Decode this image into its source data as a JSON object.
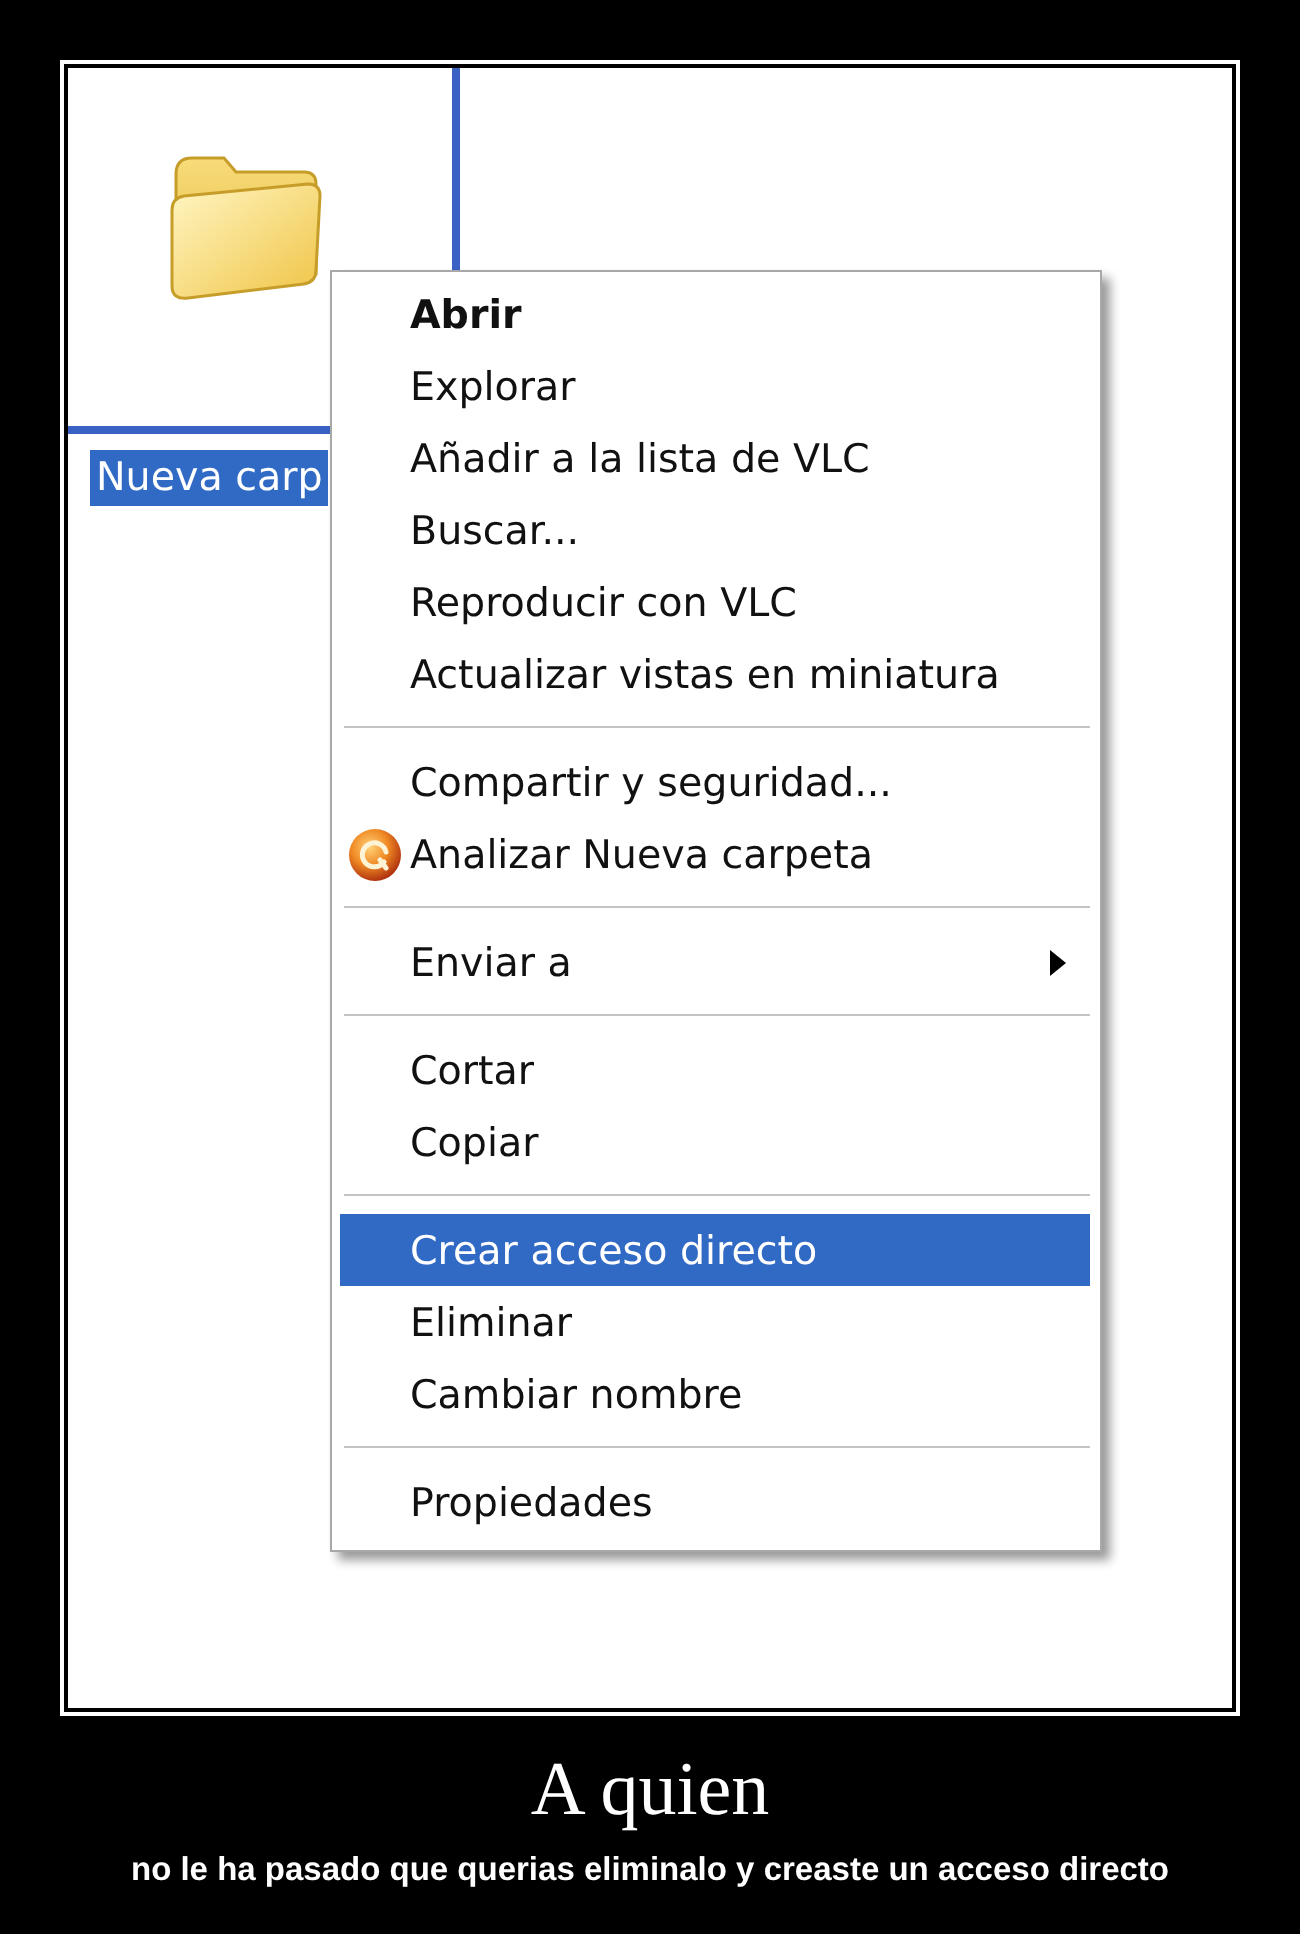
{
  "desktop": {
    "icon": {
      "label": "Nueva carp",
      "selected": true
    }
  },
  "context_menu": {
    "groups": [
      {
        "items": [
          {
            "label": "Abrir",
            "default": true,
            "selected": false,
            "has_icon": false,
            "submenu": false
          },
          {
            "label": "Explorar",
            "default": false,
            "selected": false,
            "has_icon": false,
            "submenu": false
          },
          {
            "label": "Añadir a la lista de VLC",
            "default": false,
            "selected": false,
            "has_icon": false,
            "submenu": false
          },
          {
            "label": "Buscar...",
            "default": false,
            "selected": false,
            "has_icon": false,
            "submenu": false
          },
          {
            "label": "Reproducir con VLC",
            "default": false,
            "selected": false,
            "has_icon": false,
            "submenu": false
          },
          {
            "label": "Actualizar vistas en miniatura",
            "default": false,
            "selected": false,
            "has_icon": false,
            "submenu": false
          }
        ]
      },
      {
        "items": [
          {
            "label": "Compartir y seguridad...",
            "default": false,
            "selected": false,
            "has_icon": false,
            "submenu": false
          },
          {
            "label": "Analizar Nueva carpeta",
            "default": false,
            "selected": false,
            "has_icon": true,
            "submenu": false
          }
        ]
      },
      {
        "items": [
          {
            "label": "Enviar a",
            "default": false,
            "selected": false,
            "has_icon": false,
            "submenu": true
          }
        ]
      },
      {
        "items": [
          {
            "label": "Cortar",
            "default": false,
            "selected": false,
            "has_icon": false,
            "submenu": false
          },
          {
            "label": "Copiar",
            "default": false,
            "selected": false,
            "has_icon": false,
            "submenu": false
          }
        ]
      },
      {
        "items": [
          {
            "label": "Crear acceso directo",
            "default": false,
            "selected": true,
            "has_icon": false,
            "submenu": false
          },
          {
            "label": "Eliminar",
            "default": false,
            "selected": false,
            "has_icon": false,
            "submenu": false
          },
          {
            "label": "Cambiar nombre",
            "default": false,
            "selected": false,
            "has_icon": false,
            "submenu": false
          }
        ]
      },
      {
        "items": [
          {
            "label": "Propiedades",
            "default": false,
            "selected": false,
            "has_icon": false,
            "submenu": false
          }
        ]
      }
    ]
  },
  "poster": {
    "title": "A quien",
    "caption": "no le ha pasado que querias eliminalo y creaste un acceso directo"
  }
}
